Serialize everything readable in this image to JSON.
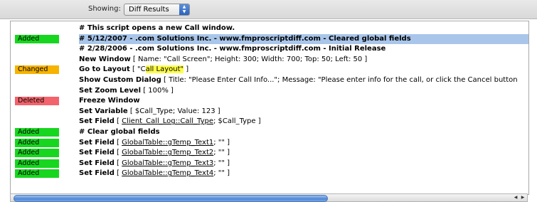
{
  "toolbar": {
    "showing_label": "Showing:",
    "view_select": "Diff Results"
  },
  "rows": [
    {
      "badge": "",
      "parts": [
        {
          "t": "#   This script opens a new Call window.",
          "s": "kw"
        }
      ]
    },
    {
      "badge": "Added",
      "status": "added",
      "selected": true,
      "parts": [
        {
          "t": "#   5/12/2007 - .com Solutions Inc. - www.fmproscriptdiff.com - Cleared global fields",
          "s": "kw"
        }
      ]
    },
    {
      "badge": "",
      "parts": [
        {
          "t": "#   2/28/2006 - .com Solutions Inc. - www.fmproscriptdiff.com - Initial Release",
          "s": "kw"
        }
      ]
    },
    {
      "badge": "",
      "parts": [
        {
          "t": "New Window",
          "s": "kw"
        },
        {
          "t": " [ Name: \"Call Screen\"; Height: 300; Width: 700; Top: 50; Left: 50 ]",
          "s": ""
        }
      ]
    },
    {
      "badge": "Changed",
      "status": "changed",
      "parts": [
        {
          "t": "Go to Layout",
          "s": "kw"
        },
        {
          "t": " [ \"",
          "s": ""
        },
        {
          "t": "C",
          "s": ""
        },
        {
          "t": "all Layout\"",
          "s": "hl"
        },
        {
          "t": " ]",
          "s": ""
        }
      ]
    },
    {
      "badge": "",
      "parts": [
        {
          "t": "Show Custom Dialog",
          "s": "kw"
        },
        {
          "t": " [ Title: \"Please Enter Call Info...\"; Message: \"Please enter info for the call, or click the Cancel button",
          "s": ""
        }
      ]
    },
    {
      "badge": "",
      "parts": [
        {
          "t": "Set Zoom Level",
          "s": "kw"
        },
        {
          "t": " [ 100% ]",
          "s": ""
        }
      ]
    },
    {
      "badge": "Deleted",
      "status": "deleted",
      "parts": [
        {
          "t": "Freeze Window",
          "s": "kw"
        }
      ]
    },
    {
      "badge": "",
      "parts": [
        {
          "t": "Set Variable",
          "s": "kw"
        },
        {
          "t": " [ $Call_Type; Value: 123 ]",
          "s": ""
        }
      ]
    },
    {
      "badge": "",
      "parts": [
        {
          "t": "Set Field",
          "s": "kw"
        },
        {
          "t": " [ ",
          "s": ""
        },
        {
          "t": "Client_Call_Log::Call_Type",
          "s": "u"
        },
        {
          "t": "; $Call_Type ]",
          "s": ""
        }
      ]
    },
    {
      "badge": "Added",
      "status": "added",
      "parts": [
        {
          "t": "#   Clear global fields",
          "s": "kw"
        }
      ]
    },
    {
      "badge": "Added",
      "status": "added",
      "parts": [
        {
          "t": "Set Field",
          "s": "kw"
        },
        {
          "t": " [ ",
          "s": ""
        },
        {
          "t": "GlobalTable::gTemp_Text1",
          "s": "u"
        },
        {
          "t": "; \"\" ]",
          "s": ""
        }
      ]
    },
    {
      "badge": "Added",
      "status": "added",
      "parts": [
        {
          "t": "Set Field",
          "s": "kw"
        },
        {
          "t": " [ ",
          "s": ""
        },
        {
          "t": "GlobalTable::gTemp_Text2",
          "s": "u"
        },
        {
          "t": "; \"\" ]",
          "s": ""
        }
      ]
    },
    {
      "badge": "Added",
      "status": "added",
      "parts": [
        {
          "t": "Set Field",
          "s": "kw"
        },
        {
          "t": " [ ",
          "s": ""
        },
        {
          "t": "GlobalTable::gTemp_Text3",
          "s": "u"
        },
        {
          "t": "; \"\" ]",
          "s": ""
        }
      ]
    },
    {
      "badge": "Added",
      "status": "added",
      "parts": [
        {
          "t": "Set Field",
          "s": "kw"
        },
        {
          "t": " [ ",
          "s": ""
        },
        {
          "t": "GlobalTable::gTemp_Text4",
          "s": "u"
        },
        {
          "t": "; \"\" ]",
          "s": ""
        }
      ]
    }
  ],
  "colors": {
    "added": "#17d61f",
    "changed": "#f6b300",
    "deleted": "#f2636b",
    "selection": "#a9c6ea",
    "highlight": "#ffff4a"
  },
  "scrollbar": {
    "left_arrow_icon": "arrow-left-icon",
    "right_arrow_icon": "arrow-right-icon"
  }
}
